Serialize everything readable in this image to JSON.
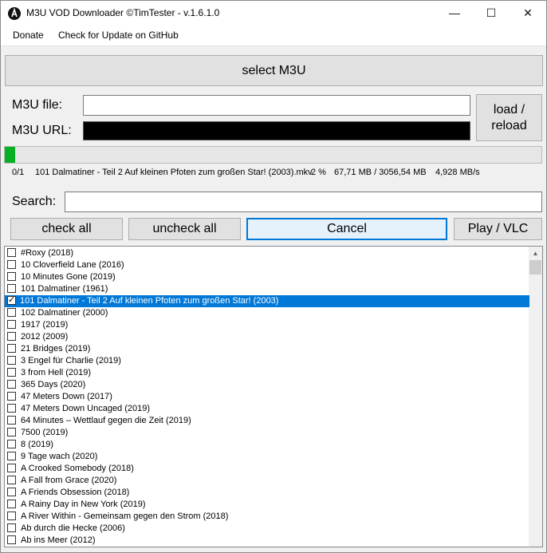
{
  "window": {
    "title": "M3U VOD Downloader ©TimTester - v.1.6.1.0",
    "minimize_glyph": "—",
    "maximize_glyph": "☐",
    "close_glyph": "✕"
  },
  "menu": {
    "donate": "Donate",
    "check_update": "Check for Update on GitHub"
  },
  "buttons": {
    "select_m3u": "select M3U",
    "load_reload_line1": "load /",
    "load_reload_line2": "reload",
    "check_all": "check all",
    "uncheck_all": "uncheck all",
    "cancel": "Cancel",
    "play_vlc": "Play / VLC"
  },
  "fields": {
    "m3u_file_label": "M3U file:",
    "m3u_file_value": "",
    "m3u_url_label": "M3U URL:",
    "search_label": "Search:",
    "search_value": ""
  },
  "progress": {
    "fraction": 0.02,
    "color": "#06b025"
  },
  "status": {
    "counter": "0/1",
    "filename": "101 Dalmatiner - Teil 2 Auf kleinen Pfoten zum großen Star! (2003).mkv",
    "percent": "2 %",
    "size": "67,71 MB / 3056,54 MB",
    "speed": "4,928 MB/s"
  },
  "list": {
    "items": [
      {
        "label": "#Roxy (2018)",
        "checked": false
      },
      {
        "label": "10 Cloverfield Lane (2016)",
        "checked": false
      },
      {
        "label": "10 Minutes Gone (2019)",
        "checked": false
      },
      {
        "label": "101 Dalmatiner (1961)",
        "checked": false
      },
      {
        "label": "101 Dalmatiner - Teil 2 Auf kleinen Pfoten zum großen Star! (2003)",
        "checked": true,
        "selected": true
      },
      {
        "label": "102 Dalmatiner (2000)",
        "checked": false
      },
      {
        "label": "1917 (2019)",
        "checked": false
      },
      {
        "label": "2012 (2009)",
        "checked": false
      },
      {
        "label": "21 Bridges (2019)",
        "checked": false
      },
      {
        "label": "3 Engel für Charlie (2019)",
        "checked": false
      },
      {
        "label": "3 from Hell (2019)",
        "checked": false
      },
      {
        "label": "365 Days (2020)",
        "checked": false
      },
      {
        "label": "47 Meters Down (2017)",
        "checked": false
      },
      {
        "label": "47 Meters Down Uncaged (2019)",
        "checked": false
      },
      {
        "label": "64 Minutes – Wettlauf gegen die Zeit (2019)",
        "checked": false
      },
      {
        "label": "7500 (2019)",
        "checked": false
      },
      {
        "label": "8 (2019)",
        "checked": false
      },
      {
        "label": "9 Tage wach (2020)",
        "checked": false
      },
      {
        "label": "A Crooked Somebody (2018)",
        "checked": false
      },
      {
        "label": "A Fall from Grace (2020)",
        "checked": false
      },
      {
        "label": "A Friends Obsession (2018)",
        "checked": false
      },
      {
        "label": "A Rainy Day in New York (2019)",
        "checked": false
      },
      {
        "label": "A River Within - Gemeinsam gegen den Strom (2018)",
        "checked": false
      },
      {
        "label": "Ab durch die Hecke (2006)",
        "checked": false
      },
      {
        "label": "Ab ins Meer (2012)",
        "checked": false
      }
    ],
    "check_glyph": "✓"
  },
  "colors": {
    "selection": "#0078d7",
    "accent_border": "#0078d7"
  }
}
